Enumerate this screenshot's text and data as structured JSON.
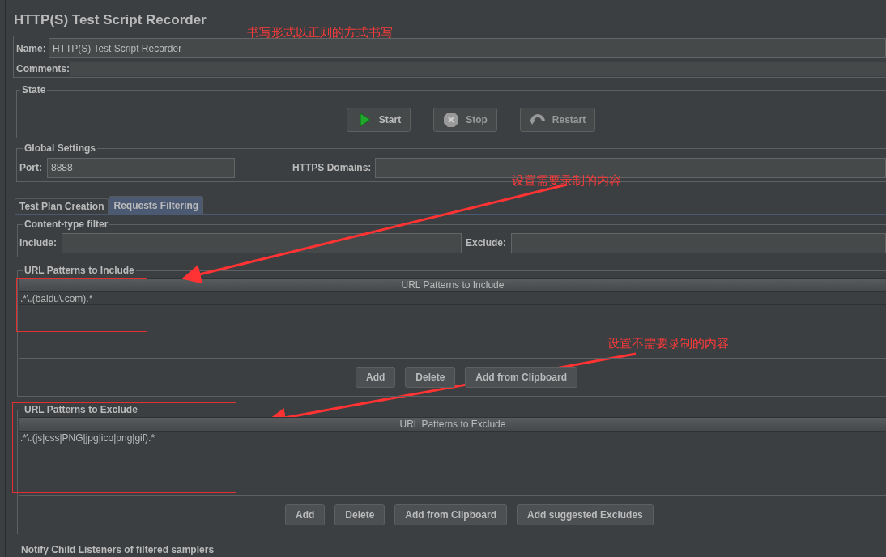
{
  "window": {
    "title": "HTTP(S) Test Script Recorder"
  },
  "name_field": {
    "label": "Name:",
    "value": "HTTP(S) Test Script Recorder"
  },
  "comments": {
    "label": "Comments:"
  },
  "state": {
    "legend": "State",
    "buttons": [
      {
        "label": "Start",
        "kind": "start",
        "disabled": false
      },
      {
        "label": "Stop",
        "kind": "stop",
        "disabled": true
      },
      {
        "label": "Restart",
        "kind": "restart",
        "disabled": true
      }
    ]
  },
  "global_settings": {
    "legend": "Global Settings",
    "port": {
      "label": "Port:",
      "value": "8888"
    },
    "https_domains": {
      "label": "HTTPS Domains:"
    }
  },
  "tabs": [
    {
      "label": "Test Plan Creation",
      "selected": false
    },
    {
      "label": "Requests Filtering",
      "selected": true
    }
  ],
  "content_type_filter": {
    "legend": "Content-type filter",
    "include": {
      "label": "Include:"
    },
    "exclude": {
      "label": "Exclude:"
    }
  },
  "include_patterns": {
    "legend": "URL Patterns to Include",
    "column": "URL Patterns to Include",
    "rows": [
      ".*\\.(baidu\\.com).*"
    ],
    "buttons": [
      "Add",
      "Delete",
      "Add from Clipboard"
    ]
  },
  "exclude_patterns": {
    "legend": "URL Patterns to Exclude",
    "column": "URL Patterns to Exclude",
    "rows": [
      ".*\\.(js|css|PNG|jpg|ico|png|gif).*"
    ],
    "buttons": [
      "Add",
      "Delete",
      "Add from Clipboard",
      "Add suggested Excludes"
    ]
  },
  "notify": {
    "label": "Notify Child Listeners of filtered samplers"
  },
  "annotations": [
    {
      "text": "书写形式以正则的方式书写"
    },
    {
      "text": "设置需要录制的内容"
    },
    {
      "text": "设置不需要录制的内容"
    }
  ]
}
